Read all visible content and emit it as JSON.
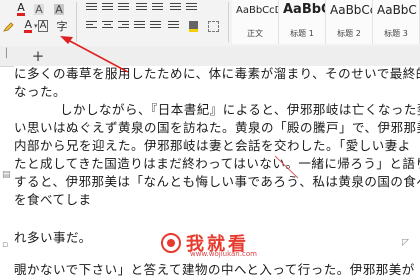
{
  "ribbon": {
    "font_color_glyph": "A",
    "highlight_glyph": "A",
    "char_shading_glyph": "A",
    "accent_red": "#e02020",
    "styles": [
      {
        "sample": "AaBbCcDd",
        "name": "正文"
      },
      {
        "sample": "AaBbC",
        "name": "标题 1"
      },
      {
        "sample": "AaBbCc",
        "name": "标题 2"
      },
      {
        "sample": "AaBbC",
        "name": "标题 3"
      }
    ]
  },
  "tabbar": {
    "add_tab": "+"
  },
  "document": {
    "lines": [
      "に多くの毒草を服用したために、体に毒素が溜まり、そのせいで最終的",
      "なった。",
      "しかしながら、『日本書紀』によると、伊邪那岐は亡くなった妻",
      "い思いはぬぐえず黄泉の国を訪ねた。黄泉の「殿の騰戸」で、伊邪那美",
      "内部から兄を迎えた。伊邪那岐は妻と会話を交わした。「愛しい妻よ",
      "たと成してきた国造りはまだ終わってはいない。一緒に帰ろう」と語り",
      "すると、伊邪那美は「なんとも悔しい事であろう、私は黄泉の国の食べ",
      "を食べてしま",
      "れ多い事だ。",
      "覗かないで下さい」と答えて建物の中へと入って行った。伊邪那美が"
    ]
  },
  "watermark": {
    "text": "我就看",
    "url": "www.wojiukan.com"
  }
}
